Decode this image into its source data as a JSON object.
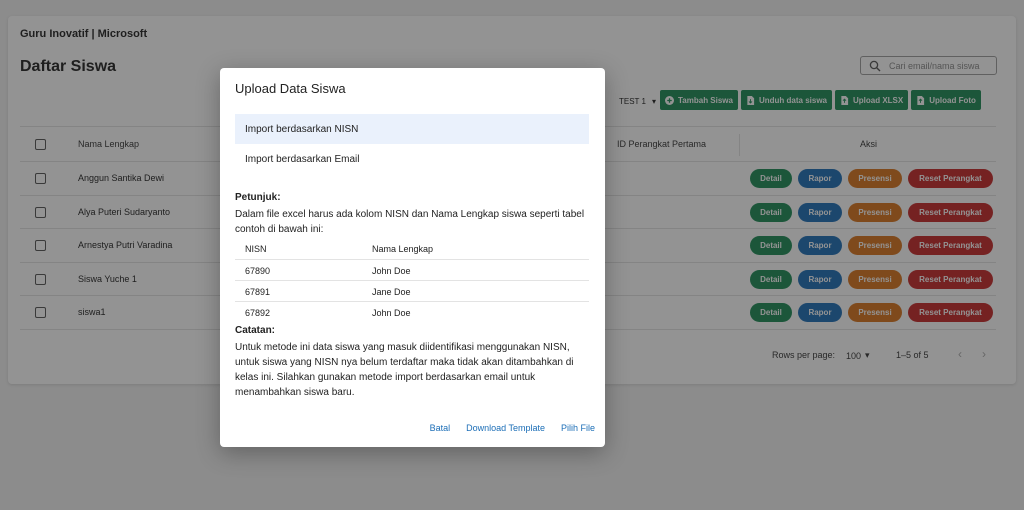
{
  "app": {
    "breadcrumb": "Guru Inovatif | Microsoft"
  },
  "page": {
    "title": "Daftar Siswa"
  },
  "search": {
    "placeholder": "Cari email/nama siswa"
  },
  "class_select": {
    "value": "TEST 1"
  },
  "toolbar": {
    "buttons": [
      {
        "label": "Tambah Siswa",
        "icon": "plus-circle-icon"
      },
      {
        "label": "Unduh data siswa",
        "icon": "file-download-icon"
      },
      {
        "label": "Upload XLSX",
        "icon": "file-upload-icon"
      },
      {
        "label": "Upload Foto",
        "icon": "file-upload-icon"
      }
    ]
  },
  "table": {
    "headers": {
      "name": "Nama Lengkap",
      "device": "ID Perangkat Pertama",
      "actions": "Aksi"
    },
    "rows": [
      {
        "name": "Anggun Santika Dewi"
      },
      {
        "name": "Alya Puteri Sudaryanto"
      },
      {
        "name": "Arnestya Putri Varadina"
      },
      {
        "name": "Siswa Yuche 1"
      },
      {
        "name": "siswa1"
      }
    ],
    "row_actions": {
      "detail": "Detail",
      "rapor": "Rapor",
      "presensi": "Presensi",
      "reset": "Reset Perangkat"
    }
  },
  "pagination": {
    "rows_per_page_label": "Rows per page:",
    "rows_per_page": "100",
    "range": "1–5 of 5"
  },
  "colors": {
    "green": "#1b8a55",
    "blue": "#1c6eb7",
    "orange": "#d9741b",
    "red": "#c62828"
  },
  "modal": {
    "title": "Upload Data Siswa",
    "options": [
      "Import berdasarkan NISN",
      "Import berdasarkan Email"
    ],
    "instructions_heading": "Petunjuk:",
    "instructions_text": "Dalam file excel harus ada kolom NISN dan Nama Lengkap siswa seperti tabel contoh di bawah ini:",
    "example": {
      "headers": [
        "NISN",
        "Nama Lengkap"
      ],
      "rows": [
        [
          "67890",
          "John Doe"
        ],
        [
          "67891",
          "Jane Doe"
        ],
        [
          "67892",
          "John Doe"
        ]
      ]
    },
    "note_heading": "Catatan:",
    "note_text": "Untuk metode ini data siswa yang masuk diidentifikasi menggunakan NISN, untuk siswa yang NISN nya belum terdaftar maka tidak akan ditambahkan di kelas ini. Silahkan gunakan metode import berdasarkan email untuk menambahkan siswa baru.",
    "actions": {
      "cancel": "Batal",
      "download": "Download Template",
      "choose": "Pilih File"
    }
  }
}
